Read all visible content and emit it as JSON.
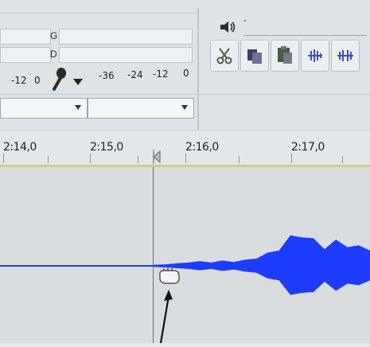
{
  "meter": {
    "channel_left": "G",
    "channel_right": "D",
    "record_scale": [
      "-12",
      "0"
    ],
    "play_scale": [
      "-36",
      "-24",
      "-12",
      "0"
    ],
    "volume_icon": "speaker-icon",
    "play_meter_dash": "-"
  },
  "toolbar": {
    "buttons": [
      {
        "name": "cut-button",
        "icon": "scissors-icon"
      },
      {
        "name": "copy-button",
        "icon": "copy-icon"
      },
      {
        "name": "paste-button",
        "icon": "paste-icon"
      },
      {
        "name": "trim-button",
        "icon": "trim-icon"
      },
      {
        "name": "silence-button",
        "icon": "silence-icon"
      }
    ]
  },
  "dropdowns": [
    {
      "name": "record-device",
      "value": ""
    },
    {
      "name": "play-device",
      "value": ""
    }
  ],
  "timeline": {
    "labels": [
      "2:14,0",
      "2:15,0",
      "2:16,0",
      "2:17,0"
    ]
  },
  "colors": {
    "waveform": "#1d3cff",
    "ruler_border": "#d3c98d",
    "track_bg": "#d9dde0",
    "panel_bg": "#dfe3e6"
  },
  "waveform": {
    "amplitude_envelope": [
      0.01,
      0.02,
      0.03,
      0.05,
      0.06,
      0.05,
      0.07,
      0.06,
      0.08,
      0.12,
      0.18,
      0.26,
      0.42,
      0.49,
      0.38,
      0.28,
      0.36,
      0.32,
      0.28,
      0.26
    ]
  }
}
